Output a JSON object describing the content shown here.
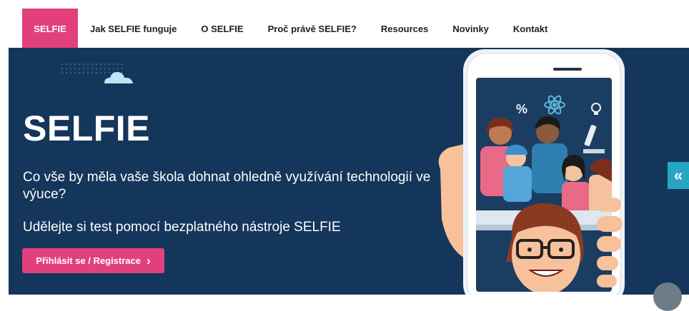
{
  "nav": {
    "items": [
      {
        "label": "SELFIE",
        "active": true
      },
      {
        "label": "Jak SELFIE funguje",
        "active": false
      },
      {
        "label": "O SELFIE",
        "active": false
      },
      {
        "label": "Proč právě SELFIE?",
        "active": false
      },
      {
        "label": "Resources",
        "active": false
      },
      {
        "label": "Novinky",
        "active": false
      },
      {
        "label": "Kontakt",
        "active": false
      }
    ]
  },
  "hero": {
    "title": "SELFIE",
    "question": "Co vše by měla vaše škola dohnat ohledně využívání technologií ve výuce?",
    "subtitle": "Udělejte si test pomocí bezplatného nástroje SELFIE",
    "cta_label": "Přihlásit se / Registrace",
    "cta_icon": "chevron-right-icon",
    "side_tab_glyph": "«",
    "phone_screen_glyphs": {
      "percent": "%"
    }
  },
  "colors": {
    "accent_pink": "#e2407d",
    "accent_teal": "#27a6c4",
    "hero_background": "#14365a",
    "nav_text": "#1f1f1f"
  }
}
